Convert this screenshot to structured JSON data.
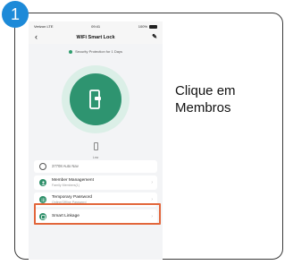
{
  "step": {
    "number": "1"
  },
  "instruction": {
    "line1": "Clique em",
    "line2": "Membros"
  },
  "phone": {
    "status_bar": {
      "carrier": "Verizon LTE",
      "time": "09:41",
      "battery": "100%"
    },
    "nav": {
      "title": "WiFi Smart Lock"
    },
    "protection_text": "Security Protection for 1 Days",
    "battery_label": "Low",
    "list": [
      {
        "title": "37708 Auto Nav",
        "subtitle": "",
        "icon": "link-icon"
      },
      {
        "title": "Member Management",
        "subtitle": "Family Members(1)",
        "icon": "user-icon"
      },
      {
        "title": "Temporary Password",
        "subtitle": "Online/Offline Password",
        "icon": "keypad-icon"
      },
      {
        "title": "Smart Linkage",
        "subtitle": "",
        "icon": "linkage-icon"
      }
    ]
  },
  "colors": {
    "accent": "#2e9470",
    "highlight": "#e2663b",
    "step_badge": "#1d8ad8"
  }
}
